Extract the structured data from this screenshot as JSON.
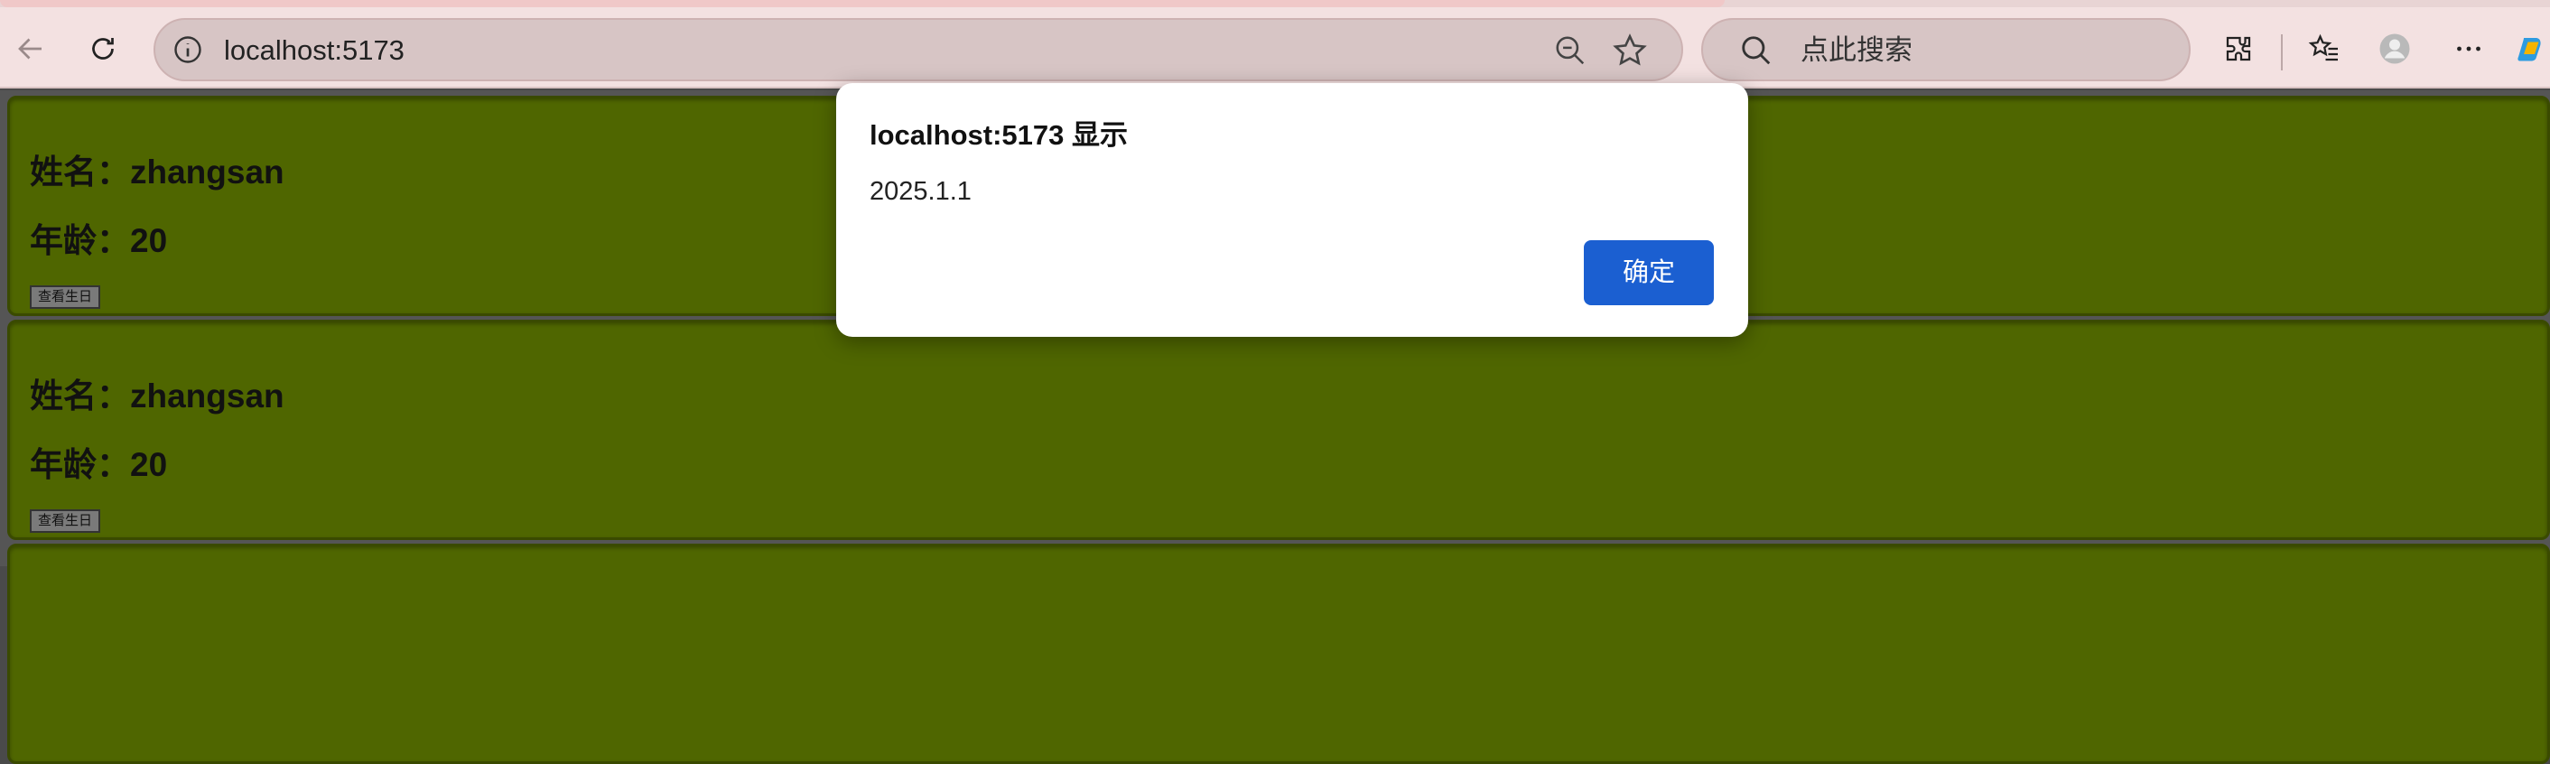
{
  "browser": {
    "url": "localhost:5173",
    "search_placeholder": "点此搜索"
  },
  "cards": [
    {
      "name_line": "姓名：zhangsan",
      "age_line": "年龄：20",
      "button_label": "查看生日"
    },
    {
      "name_line": "姓名：zhangsan",
      "age_line": "年龄：20",
      "button_label": "查看生日"
    }
  ],
  "alert": {
    "title": "localhost:5173 显示",
    "message": "2025.1.1",
    "ok_label": "确定"
  },
  "icons": [
    "back-icon",
    "refresh-icon",
    "info-icon",
    "zoom-out-icon",
    "favorite-star-icon",
    "search-icon",
    "extensions-icon",
    "favorites-icon",
    "profile-avatar-icon",
    "more-icon",
    "copilot-icon"
  ],
  "colors": {
    "card_bg": "#4f6600",
    "accent": "#1b5fd1",
    "toolbar_bg": "#f3e1e1"
  }
}
